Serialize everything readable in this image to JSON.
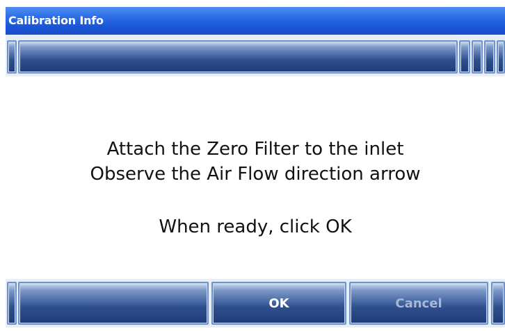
{
  "window": {
    "title": "Calibration Info"
  },
  "message": {
    "line1": "Attach the Zero Filter to the inlet",
    "line2": "Observe the Air Flow direction arrow",
    "line3": "When ready, click OK"
  },
  "buttons": {
    "ok_label": "OK",
    "cancel_label": "Cancel"
  },
  "colors": {
    "titlebar": "#1a56d6",
    "button": "#2f4f8c",
    "text": "#111111"
  }
}
